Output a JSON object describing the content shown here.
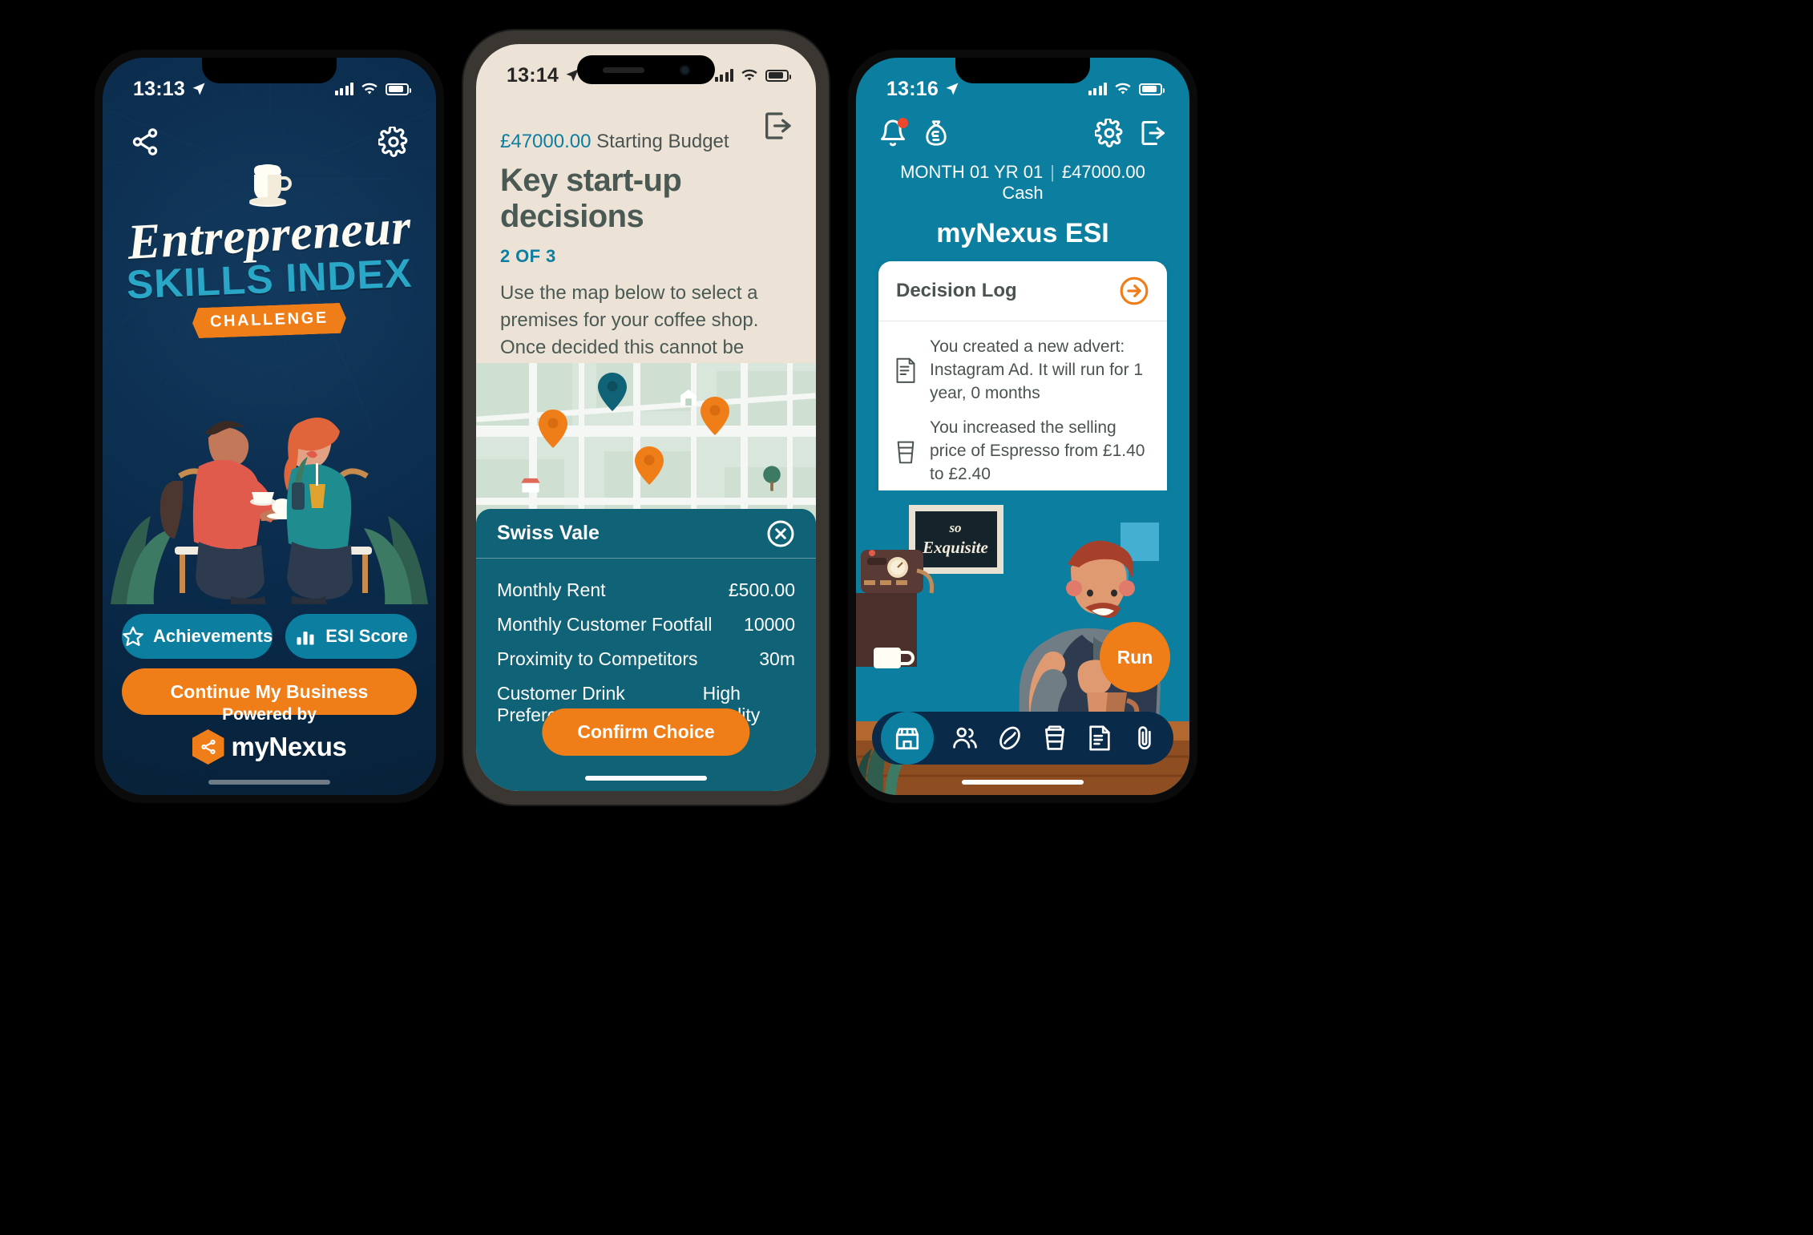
{
  "phone1": {
    "status": {
      "time": "13:13"
    },
    "icons": {
      "share": "share-icon",
      "settings": "gear-icon"
    },
    "logo": {
      "line1": "Entrepreneur",
      "line2": "SKILLS INDEX",
      "badge": "CHALLENGE",
      "cup": "coffee-cup-icon"
    },
    "buttons": {
      "achievements": "Achievements",
      "esi_score": "ESI Score",
      "continue": "Continue My Business"
    },
    "footer": {
      "powered": "Powered by",
      "brand": "myNexus"
    },
    "colors": {
      "bg": "#0a2a4a",
      "teal": "#0c7ea0",
      "orange": "#ef7d18",
      "accent": "#2aa6c6"
    }
  },
  "phone2": {
    "status": {
      "time": "13:14"
    },
    "header": {
      "budget_amount": "£47000.00",
      "budget_label": " Starting Budget",
      "title": "Key start-up decisions",
      "step": "2 OF 3",
      "body": "Use the map below to select a premises for your coffee shop. Once decided this cannot be changed. Some locations may be unavailable until you progress.",
      "exit_icon": "exit-icon"
    },
    "sheet": {
      "location_name": "Swiss Vale",
      "close_icon": "close-circle-icon",
      "rows": [
        {
          "label": "Monthly Rent",
          "value": "£500.00"
        },
        {
          "label": "Monthly Customer Footfall",
          "value": "10000"
        },
        {
          "label": "Proximity to Competitors",
          "value": "30m"
        },
        {
          "label": "Customer Drink Preference",
          "value": "High Quality"
        }
      ],
      "confirm": "Confirm Choice"
    },
    "colors": {
      "bg": "#ece3d6",
      "sheet": "#106277",
      "teal": "#0c7ea0",
      "orange": "#ef7d18"
    }
  },
  "phone3": {
    "status": {
      "time": "13:16"
    },
    "header": {
      "bell_icon": "bell-icon",
      "money_icon": "money-bag-icon",
      "settings_icon": "gear-icon",
      "exit_icon": "exit-icon",
      "month": "MONTH 01 YR 01",
      "separator": "|",
      "cash": "£47000.00 Cash",
      "app_title": "myNexus ESI"
    },
    "card": {
      "title": "Decision Log",
      "arrow_icon": "arrow-right-circle-icon",
      "entries": [
        {
          "icon": "document-icon",
          "text": "You created a new advert: Instagram Ad. It will run for 1 year, 0 months"
        },
        {
          "icon": "cup-icon",
          "text": "You increased the selling price of Espresso from £1.40 to £2.40"
        }
      ]
    },
    "scene": {
      "sign_top": "so",
      "sign_bottom": "Exquisite"
    },
    "run_button": "Run",
    "nav": [
      {
        "name": "store",
        "active": true
      },
      {
        "name": "people",
        "active": false
      },
      {
        "name": "coffee-bean",
        "active": false
      },
      {
        "name": "cup",
        "active": false
      },
      {
        "name": "document",
        "active": false
      },
      {
        "name": "paperclip",
        "active": false
      }
    ],
    "colors": {
      "bg": "#0c7ea0",
      "navbar": "#0a2a4a",
      "orange": "#ef7d18"
    }
  }
}
